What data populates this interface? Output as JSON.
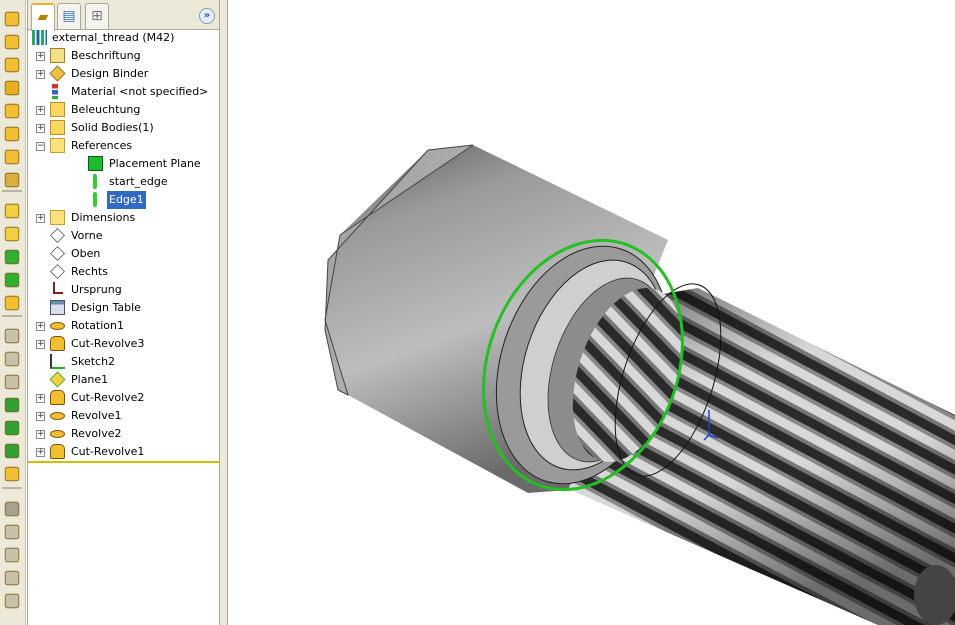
{
  "panel": {
    "tabs": [
      {
        "name": "featuremanager-tab",
        "icon": "featuremanager-icon"
      },
      {
        "name": "propertymanager-tab",
        "icon": "propertymanager-icon"
      },
      {
        "name": "configurationmanager-tab",
        "icon": "configurationmanager-icon"
      }
    ],
    "expand_label": "»",
    "root": "external_thread  (M42)",
    "tree": [
      {
        "label": "Beschriftung",
        "icon": "annotations-icon",
        "expandable": true,
        "expanded": false,
        "level": 0
      },
      {
        "label": "Design Binder",
        "icon": "design-binder-icon",
        "expandable": true,
        "expanded": false,
        "level": 0
      },
      {
        "label": "Material <not specified>",
        "icon": "material-icon",
        "expandable": false,
        "level": 0
      },
      {
        "label": "Beleuchtung",
        "icon": "lighting-folder-icon",
        "expandable": true,
        "expanded": false,
        "level": 0
      },
      {
        "label": "Solid Bodies(1)",
        "icon": "solid-bodies-icon",
        "expandable": true,
        "expanded": false,
        "level": 0
      },
      {
        "label": "References",
        "icon": "folder-icon",
        "expandable": true,
        "expanded": true,
        "level": 0
      },
      {
        "label": "Placement Plane",
        "icon": "placement-plane-icon",
        "expandable": false,
        "level": 1
      },
      {
        "label": "start_edge",
        "icon": "edge-icon",
        "expandable": false,
        "level": 1
      },
      {
        "label": "Edge1",
        "icon": "edge-icon",
        "expandable": false,
        "level": 1,
        "selected": true
      },
      {
        "label": "Dimensions",
        "icon": "folder-icon",
        "expandable": true,
        "expanded": false,
        "level": 0
      },
      {
        "label": "Vorne",
        "icon": "plane-icon",
        "expandable": false,
        "level": 0
      },
      {
        "label": "Oben",
        "icon": "plane-icon",
        "expandable": false,
        "level": 0
      },
      {
        "label": "Rechts",
        "icon": "plane-icon",
        "expandable": false,
        "level": 0
      },
      {
        "label": "Ursprung",
        "icon": "origin-icon",
        "expandable": false,
        "level": 0
      },
      {
        "label": "Design Table",
        "icon": "design-table-icon",
        "expandable": false,
        "level": 0
      },
      {
        "label": "Rotation1",
        "icon": "revolve-icon",
        "expandable": true,
        "expanded": false,
        "level": 0
      },
      {
        "label": "Cut-Revolve3",
        "icon": "cut-revolve-icon",
        "expandable": true,
        "expanded": false,
        "level": 0
      },
      {
        "label": "Sketch2",
        "icon": "sketch-icon",
        "expandable": false,
        "level": 0
      },
      {
        "label": "Plane1",
        "icon": "plane-feature-icon",
        "expandable": false,
        "level": 0
      },
      {
        "label": "Cut-Revolve2",
        "icon": "cut-revolve-icon",
        "expandable": true,
        "expanded": false,
        "level": 0
      },
      {
        "label": "Revolve1",
        "icon": "revolve-icon",
        "expandable": true,
        "expanded": false,
        "level": 0
      },
      {
        "label": "Revolve2",
        "icon": "revolve-icon",
        "expandable": true,
        "expanded": false,
        "level": 0
      },
      {
        "label": "Cut-Revolve1",
        "icon": "cut-revolve-icon",
        "expandable": true,
        "expanded": false,
        "level": 0
      }
    ]
  },
  "colors": {
    "selection": "#316ac5",
    "highlight_edge": "#22c022",
    "rollback_bar": "#d4c000"
  }
}
